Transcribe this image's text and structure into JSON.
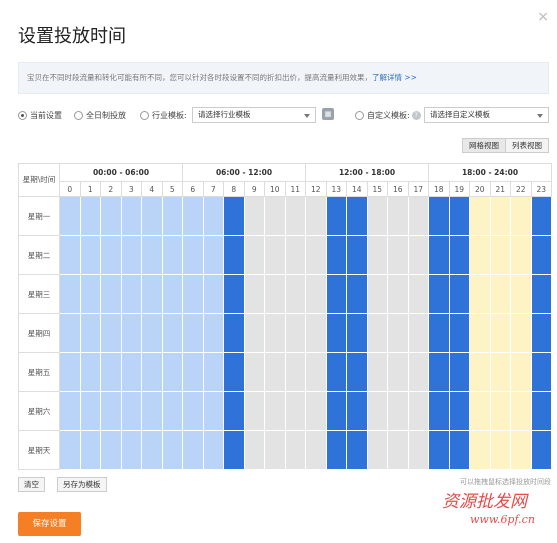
{
  "dialog": {
    "title": "设置投放时间",
    "close_glyph": "×"
  },
  "info": {
    "text": "宝贝在不同时段流量和转化可能有所不同，您可以针对各时段设置不同的折扣出价，提高流量利用效果，",
    "link": "了解详情 >>"
  },
  "options": {
    "current": "当前设置",
    "all_day": "全日制投放",
    "industry_label": "行业模板:",
    "industry_select": "请选择行业模板",
    "custom_label": "自定义模板:",
    "custom_select": "请选择自定义模板",
    "selected": "current"
  },
  "view_buttons": {
    "grid": "网格视图",
    "list": "列表视图"
  },
  "grid": {
    "corner": "星期\\时间",
    "periods": [
      "00:00 - 06:00",
      "06:00 - 12:00",
      "12:00 - 18:00",
      "18:00 - 24:00"
    ],
    "hours": [
      "0",
      "1",
      "2",
      "3",
      "4",
      "5",
      "6",
      "7",
      "8",
      "9",
      "10",
      "11",
      "12",
      "13",
      "14",
      "15",
      "16",
      "17",
      "18",
      "19",
      "20",
      "21",
      "22",
      "23"
    ],
    "days": [
      "星期一",
      "星期二",
      "星期三",
      "星期四",
      "星期五",
      "星期六",
      "星期天"
    ],
    "hour_state": [
      "light",
      "light",
      "light",
      "light",
      "light",
      "light",
      "light",
      "light",
      "dark",
      "grey",
      "grey",
      "grey",
      "grey",
      "dark",
      "dark",
      "grey",
      "grey",
      "grey",
      "dark",
      "dark",
      "yellow",
      "yellow",
      "yellow",
      "dark"
    ]
  },
  "colors": {
    "light": "#b9d4f7",
    "dark": "#2f72d8",
    "grey": "#e3e3e3",
    "yellow": "#fdf3c4",
    "grid_line": "#ffffff",
    "accent": "#f47f24"
  },
  "bottom": {
    "clear": "清空",
    "save_template": "另存为模板",
    "hint": "可以拖拽鼠标选择投放时间段",
    "save": "保存设置"
  },
  "watermark": {
    "line1": "资源批发网",
    "line2": "www.6pf.cn"
  }
}
